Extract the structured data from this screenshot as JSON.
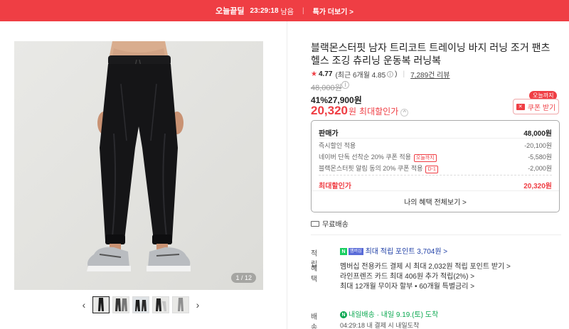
{
  "banner": {
    "deal_label": "오늘끝딜",
    "timer": "23:29:18",
    "remaining": "남음",
    "more_label": "특가 더보기 >"
  },
  "gallery": {
    "counter": "1 / 12",
    "thumb_count": 5,
    "prev_icon": "chevron-left-icon",
    "next_icon": "chevron-right-icon"
  },
  "product": {
    "title": "블랙몬스터핏 남자 트리코트 트레이닝 바지 러닝 조거 팬츠 헬스 조깅 츄리닝 운동복 러닝복",
    "rating": "4.77",
    "rating_recent": "(최근 6개월 4.85",
    "rating_close": ")",
    "reviews": "7,289건 리뷰",
    "original_price": "48,000원",
    "sale_pct": "41%",
    "sale_price": "27,900원",
    "best_price": "20,320",
    "best_won": "원",
    "best_label": "최대할인가"
  },
  "coupon": {
    "tag": "오늘까지",
    "button_label": "쿠폰 받기"
  },
  "price_box": {
    "rows": [
      {
        "label": "판매가",
        "value": "48,000원"
      },
      {
        "label": "즉시할인 적용",
        "value": "-20,100원"
      },
      {
        "label": "네이버 단독 선착순 20% 쿠폰 적용",
        "badge": "오늘까지",
        "value": "-5,580원"
      },
      {
        "label": "블랙몬스터핏 알림 동의 20% 쿠폰 적용",
        "badge": "D-1",
        "value": "-2,000원"
      }
    ],
    "total_label": "최대할인가",
    "total_value": "20,320원",
    "benefits_label": "나의 혜택 전체보기 >"
  },
  "shipping": {
    "free_label": "무료배송"
  },
  "points": {
    "key": "적립",
    "badge_n": "N",
    "badge_m": "멤버십",
    "text": "최대 적립 포인트 3,704원 >"
  },
  "perks": {
    "key": "혜택",
    "lines": [
      "멤버십 전용카드 결제 시 최대 2,032원 적립 포인트 받기 >",
      "라인프렌즈 카드 최대 406원 추가 적립(2%) >",
      "최대 12개월 무이자 할부 • 60개월 특별금리 >"
    ]
  },
  "delivery": {
    "key": "배송",
    "badge": "N",
    "tag": "내일배송",
    "arrival": "· 내일 9.19.(토) 도착",
    "note": "04:29:18  내 결제 시 내일도착"
  },
  "colors": {
    "accent": "#ef3e44",
    "npay_green": "#19ce60",
    "link_blue": "#1f3fa6"
  }
}
